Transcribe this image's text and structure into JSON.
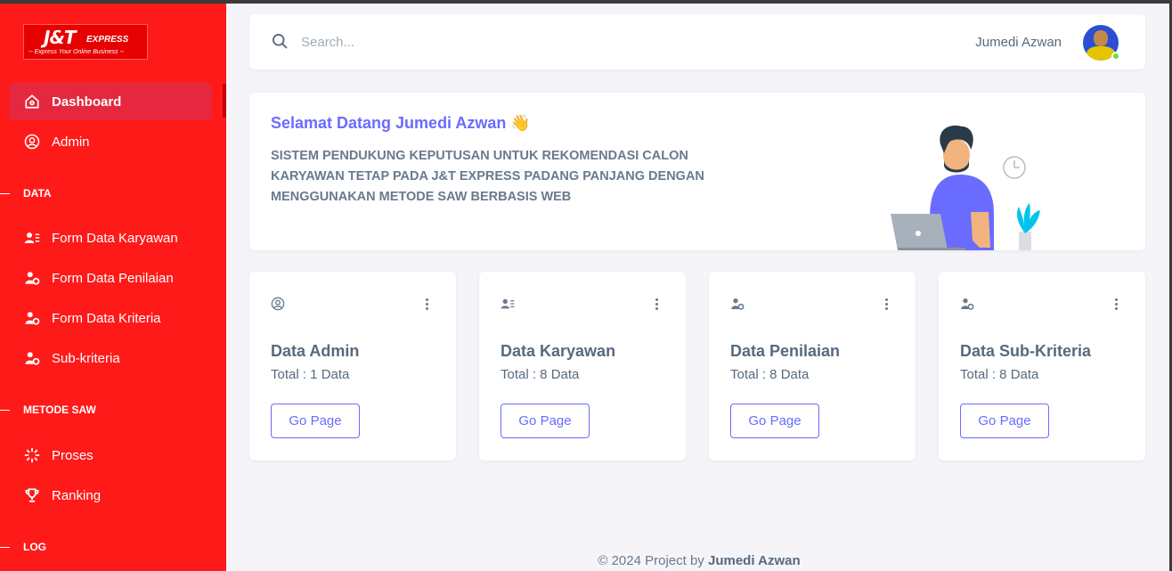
{
  "brand": {
    "name": "J&T",
    "sub": "EXPRESS",
    "tagline": "-- Express Your Online Business --"
  },
  "sidebar": {
    "items": [
      {
        "label": "Dashboard",
        "icon": "home-icon",
        "active": true
      },
      {
        "label": "Admin",
        "icon": "user-circle-icon"
      }
    ],
    "sections": [
      {
        "title": "DATA",
        "items": [
          {
            "label": "Form Data Karyawan",
            "icon": "user-list-icon"
          },
          {
            "label": "Form Data Penilaian",
            "icon": "user-gear-icon"
          },
          {
            "label": "Form Data Kriteria",
            "icon": "user-gear-icon"
          },
          {
            "label": "Sub-kriteria",
            "icon": "user-gear-icon"
          }
        ]
      },
      {
        "title": "METODE SAW",
        "items": [
          {
            "label": "Proses",
            "icon": "loader-icon"
          },
          {
            "label": "Ranking",
            "icon": "trophy-icon"
          }
        ]
      },
      {
        "title": "LOG",
        "items": []
      }
    ]
  },
  "header": {
    "search_placeholder": "Search...",
    "user_name": "Jumedi Azwan"
  },
  "welcome": {
    "title": "Selamat Datang Jumedi Azwan 👋",
    "description": "SISTEM PENDUKUNG KEPUTUSAN UNTUK REKOMENDASI CALON KARYAWAN TETAP PADA J&T EXPRESS PADANG PANJANG DENGAN MENGGUNAKAN METODE SAW BERBASIS WEB"
  },
  "cards": [
    {
      "title": "Data Admin",
      "total": "Total : 1 Data",
      "button": "Go Page",
      "icon": "user-circle-icon"
    },
    {
      "title": "Data Karyawan",
      "total": "Total : 8 Data",
      "button": "Go Page",
      "icon": "user-list-icon"
    },
    {
      "title": "Data Penilaian",
      "total": "Total : 8 Data",
      "button": "Go Page",
      "icon": "user-gear-icon"
    },
    {
      "title": "Data Sub-Kriteria",
      "total": "Total : 8 Data",
      "button": "Go Page",
      "icon": "user-gear-icon"
    }
  ],
  "footer": {
    "prefix": "© 2024 Project by",
    "author": "Jumedi Azwan"
  },
  "colors": {
    "sidebar": "#ff1a1a",
    "active_item": "#e5283f",
    "accent": "#696cff",
    "text": "#566a7f",
    "background": "#f5f5f9"
  }
}
